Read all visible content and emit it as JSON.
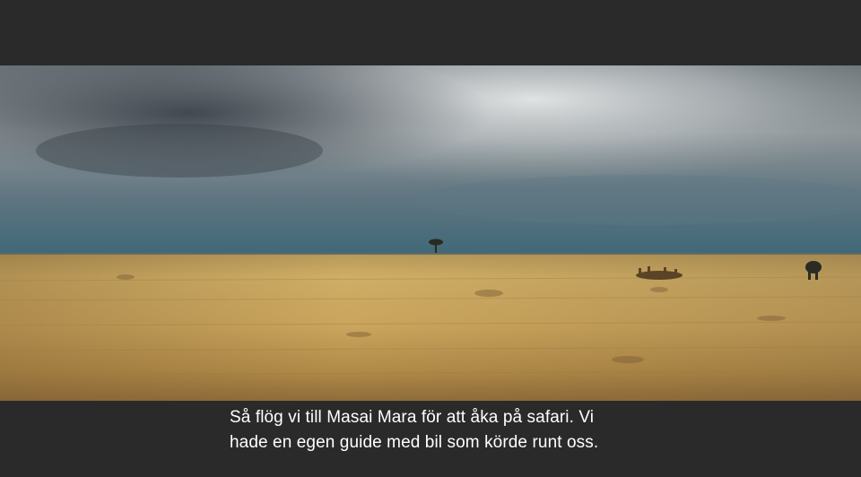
{
  "slide": {
    "background": "#2a2a2a",
    "caption": "Så flög vi till Masai Mara för att åka på safari. Vi hade en egen guide med bil som körde runt oss.",
    "caption_color": "#ffffff"
  },
  "photo": {
    "subject": "savanna-landscape-photo",
    "colors": {
      "sky_dark": "#3d4a55",
      "sky_light": "#cfd3d4",
      "horizon": "#466a78",
      "grass_light": "#d4b266",
      "grass_dark": "#8a6a38"
    }
  }
}
